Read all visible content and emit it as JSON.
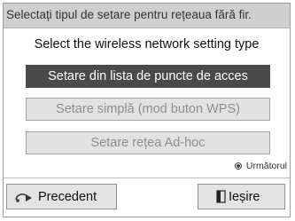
{
  "dialog": {
    "title": "Selectați tipul de setare pentru rețeaua fără fir.",
    "header": "Select the wireless network setting type",
    "options": [
      {
        "label": "Setare din lista de puncte de acces",
        "state": "selected"
      },
      {
        "label": "Setare simplă (mod buton WPS)",
        "state": "normal"
      },
      {
        "label": "Setare rețea Ad-hoc",
        "state": "normal"
      }
    ],
    "hint": {
      "icon": "select-button-icon",
      "label": "Următorul"
    },
    "buttons": {
      "previous": {
        "label": "Precedent",
        "icon": "back-arrow-icon"
      },
      "exit": {
        "label": "Ieșire",
        "icon": "exit-door-icon"
      }
    }
  },
  "colors": {
    "title_bar_bg": "#cfcfcf",
    "selected_option_bg": "#4a4a4a",
    "option_bg": "#e2e2e2",
    "option_text": "#8e8e8e",
    "button_bg": "#e3e3e3"
  }
}
